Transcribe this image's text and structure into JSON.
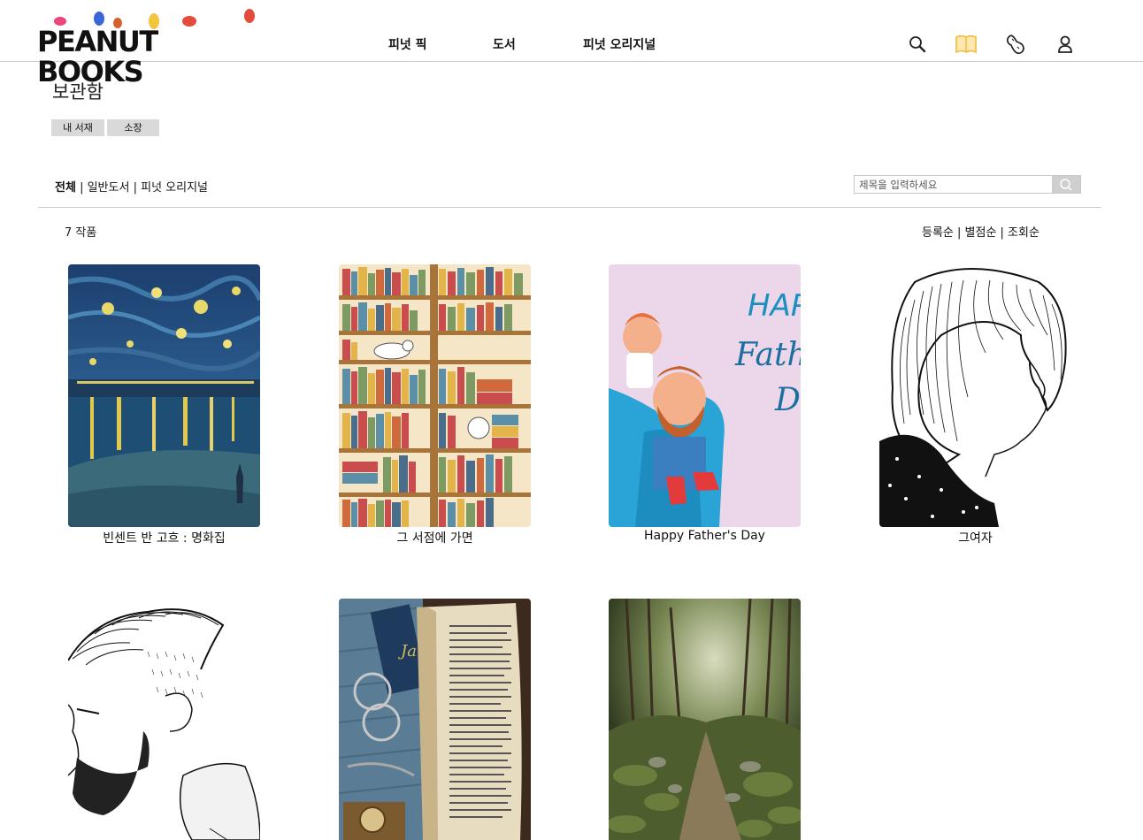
{
  "header": {
    "logo_text": "PEANUT BOOKS",
    "nav": [
      "피넛 픽",
      "도서",
      "피넛 오리지널"
    ],
    "icons": [
      "search-icon",
      "book-icon",
      "peanut-icon",
      "user-icon"
    ],
    "accent_color": "#f6c84a"
  },
  "page": {
    "title": "보관함",
    "tabs": [
      "내 서재",
      "소장"
    ],
    "filters": {
      "active": "전체",
      "separator": "|",
      "items": [
        "일반도서",
        "피넛 오리지널"
      ]
    },
    "search": {
      "placeholder": "제목을 입력하세요"
    },
    "count": "7 작품",
    "sort": "등록순 | 별점순 | 조회순"
  },
  "books": [
    {
      "title": "빈센트 반 고흐 : 명화집",
      "cover": "starry-night-painting"
    },
    {
      "title": "그 서점에 가면",
      "cover": "bookshelf-illustration"
    },
    {
      "title": "Happy Father's Day",
      "cover": "father-day-illustration",
      "cover_text": [
        "HAPPY",
        "Father",
        "Day"
      ]
    },
    {
      "title": "그여자",
      "cover": "woman-sketch"
    },
    {
      "title": "",
      "cover": "man-sketch"
    },
    {
      "title": "",
      "cover": "old-book-photo"
    },
    {
      "title": "",
      "cover": "forest-path-photo"
    }
  ]
}
